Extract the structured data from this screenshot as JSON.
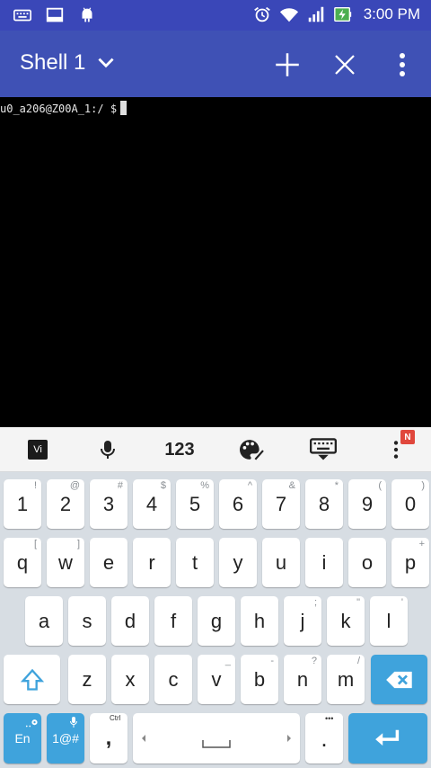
{
  "status_bar": {
    "time": "3:00 PM",
    "left_icons": [
      "keyboard-icon",
      "screen-icon",
      "android-debug-icon"
    ],
    "right_icons": [
      "alarm-icon",
      "wifi-icon",
      "signal-icon",
      "battery-charging-icon"
    ]
  },
  "app_bar": {
    "title": "Shell 1",
    "actions": [
      "add-icon",
      "close-icon",
      "overflow-menu-icon"
    ]
  },
  "terminal": {
    "prompt": "u0_a206@Z00A_1:/ $"
  },
  "keyboard_toolbar": {
    "vi_label": "Vi",
    "numbers_label": "123",
    "notification_badge": "N",
    "icons": [
      "microphone-icon",
      "palette-icon",
      "hide-keyboard-icon",
      "toolbar-menu-icon"
    ]
  },
  "keyboard": {
    "row1": [
      {
        "main": "1",
        "sub": "!"
      },
      {
        "main": "2",
        "sub": "@"
      },
      {
        "main": "3",
        "sub": "#"
      },
      {
        "main": "4",
        "sub": "$"
      },
      {
        "main": "5",
        "sub": "%"
      },
      {
        "main": "6",
        "sub": "^"
      },
      {
        "main": "7",
        "sub": "&"
      },
      {
        "main": "8",
        "sub": "*"
      },
      {
        "main": "9",
        "sub": "("
      },
      {
        "main": "0",
        "sub": ")"
      }
    ],
    "row2": [
      {
        "main": "q",
        "sub": "["
      },
      {
        "main": "w",
        "sub": "]"
      },
      {
        "main": "e",
        "sub": ""
      },
      {
        "main": "r",
        "sub": ""
      },
      {
        "main": "t",
        "sub": ""
      },
      {
        "main": "y",
        "sub": ""
      },
      {
        "main": "u",
        "sub": ""
      },
      {
        "main": "i",
        "sub": ""
      },
      {
        "main": "o",
        "sub": ""
      },
      {
        "main": "p",
        "sub": "+"
      }
    ],
    "row3": [
      {
        "main": "a",
        "sub": ""
      },
      {
        "main": "s",
        "sub": ""
      },
      {
        "main": "d",
        "sub": ""
      },
      {
        "main": "f",
        "sub": ""
      },
      {
        "main": "g",
        "sub": ""
      },
      {
        "main": "h",
        "sub": ""
      },
      {
        "main": "j",
        "sub": ";"
      },
      {
        "main": "k",
        "sub": "\""
      },
      {
        "main": "l",
        "sub": "'"
      }
    ],
    "row4": [
      {
        "main": "z",
        "sub": ""
      },
      {
        "main": "x",
        "sub": ""
      },
      {
        "main": "c",
        "sub": ""
      },
      {
        "main": "v",
        "sub": "_"
      },
      {
        "main": "b",
        "sub": "-"
      },
      {
        "main": "n",
        "sub": "?"
      },
      {
        "main": "m",
        "sub": "/"
      }
    ],
    "lang_label": "En",
    "symbols_label": "1@#",
    "comma_label": ",",
    "comma_sub": "Ctrl",
    "period_label": ".",
    "period_sub": "•••",
    "colors": {
      "accent_key": "#3fa3dc",
      "key": "#ffffff",
      "keyboard_bg": "#d7dde3"
    }
  },
  "colors": {
    "status_bar": "#3a47b8",
    "app_bar": "#3f51b5",
    "terminal_bg": "#000000"
  }
}
